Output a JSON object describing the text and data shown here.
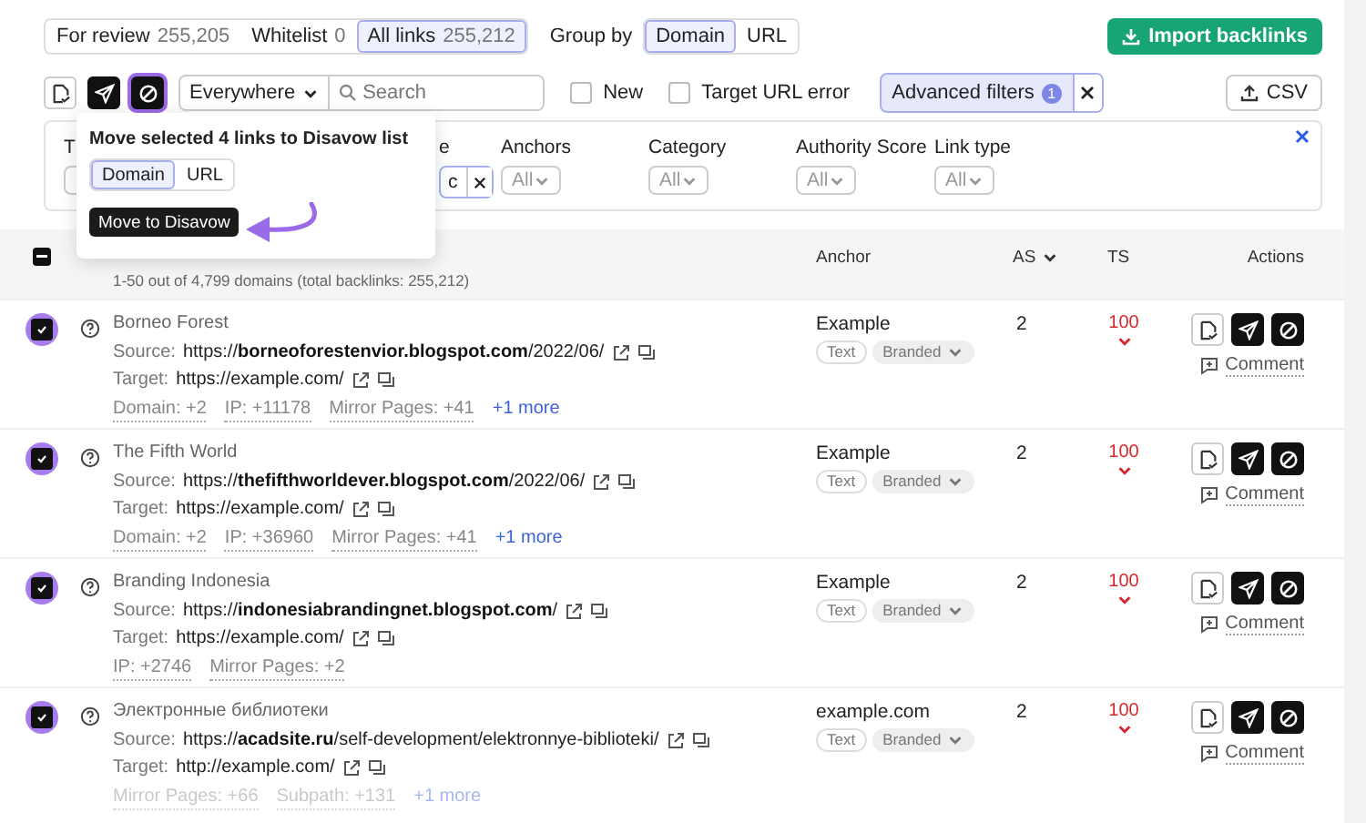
{
  "tabs": [
    {
      "label": "For review",
      "count": "255,205",
      "selected": false
    },
    {
      "label": "Whitelist",
      "count": "0",
      "selected": false
    },
    {
      "label": "All links",
      "count": "255,212",
      "selected": true
    }
  ],
  "group_by": {
    "label": "Group by",
    "options": [
      {
        "label": "Domain",
        "selected": true
      },
      {
        "label": "URL",
        "selected": false
      }
    ]
  },
  "import_button": "Import backlinks",
  "toolbar": {
    "actions": [
      {
        "kind": "review",
        "highlighted": false
      },
      {
        "kind": "send",
        "highlighted": false
      },
      {
        "kind": "disavow",
        "highlighted": true
      }
    ],
    "scope": "Everywhere",
    "search": {
      "placeholder": "Search"
    },
    "checkboxes": [
      {
        "label": "New",
        "checked": false
      },
      {
        "label": "Target URL error",
        "checked": false
      }
    ],
    "advanced_filters": {
      "label": "Advanced filters",
      "count": "1"
    },
    "export": "CSV"
  },
  "filters": [
    {
      "label": "T"
    },
    {
      "label": "e",
      "value": "c"
    },
    {
      "label": "Anchors",
      "placeholder": "All"
    },
    {
      "label": "Category",
      "placeholder": "All"
    },
    {
      "label": "Authority Score",
      "placeholder": "All"
    },
    {
      "label": "Link type",
      "placeholder": "All"
    }
  ],
  "popover": {
    "title": "Move selected 4 links to Disavow list",
    "options": [
      {
        "label": "Domain",
        "selected": true
      },
      {
        "label": "URL",
        "selected": false
      }
    ],
    "button": "Move to Disavow"
  },
  "table": {
    "select_all": {
      "indeterminate": true
    },
    "summary": "1-50 out of 4,799 domains (total backlinks: 255,212)",
    "columns": [
      "Anchor",
      "AS",
      "TS",
      "Actions"
    ],
    "rows": [
      {
        "selected": true,
        "highlighted": true,
        "title": "Borneo Forest",
        "source_label": "Source:",
        "source": "https://**borneoforestenvior.blogspot.com**/2022/06/",
        "target_label": "Target:",
        "target": "https://example.com/",
        "meta": [
          {
            "kind": "tag",
            "text": "Domain: +2"
          },
          {
            "kind": "tag",
            "text": "IP: +11178"
          },
          {
            "kind": "tag",
            "text": "Mirror Pages: +41"
          },
          {
            "kind": "more",
            "text": "+1 more"
          }
        ],
        "anchor": "Example",
        "anchor_tags": [
          "Text",
          "Branded"
        ],
        "as": "2",
        "ts": "100",
        "comment": "Comment"
      },
      {
        "selected": true,
        "highlighted": true,
        "title": "The Fifth World",
        "source_label": "Source:",
        "source": "https://**thefifthworldever.blogspot.com**/2022/06/",
        "target_label": "Target:",
        "target": "https://example.com/",
        "meta": [
          {
            "kind": "tag",
            "text": "Domain: +2"
          },
          {
            "kind": "tag",
            "text": "IP: +36960"
          },
          {
            "kind": "tag",
            "text": "Mirror Pages: +41"
          },
          {
            "kind": "more",
            "text": "+1 more"
          }
        ],
        "anchor": "Example",
        "anchor_tags": [
          "Text",
          "Branded"
        ],
        "as": "2",
        "ts": "100",
        "comment": "Comment"
      },
      {
        "selected": true,
        "highlighted": true,
        "title": "Branding Indonesia",
        "source_label": "Source:",
        "source": "https://**indonesiabrandingnet.blogspot.com**/",
        "target_label": "Target:",
        "target": "https://example.com/",
        "meta": [
          {
            "kind": "tag",
            "text": "IP: +2746"
          },
          {
            "kind": "tag",
            "text": "Mirror Pages: +2"
          }
        ],
        "anchor": "Example",
        "anchor_tags": [
          "Text",
          "Branded"
        ],
        "as": "2",
        "ts": "100",
        "comment": "Comment"
      },
      {
        "selected": true,
        "highlighted": true,
        "title": "Электронные библиотеки",
        "source_label": "Source:",
        "source": "https://**acadsite.ru**/self-development/elektronnye-biblioteki/",
        "target_label": "Target:",
        "target": "http://example.com/",
        "meta": [
          {
            "kind": "tag",
            "text": "Mirror Pages: +66"
          },
          {
            "kind": "tag",
            "text": "Subpath: +131"
          },
          {
            "kind": "more",
            "text": "+1 more"
          }
        ],
        "anchor": "example.com",
        "anchor_tags": [
          "Text",
          "Branded"
        ],
        "as": "2",
        "ts": "100",
        "comment": "Comment"
      }
    ]
  }
}
